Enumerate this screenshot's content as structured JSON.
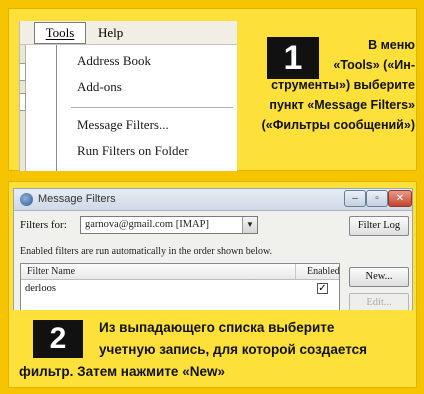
{
  "step1": {
    "number": "1",
    "caption_lines": [
      "В меню",
      "«Tools» («Ин-",
      "струменты») выберите",
      "пункт «Message Filters»",
      "(«Фильтры сообщений»)"
    ],
    "menubar": {
      "tools": "Tools",
      "help": "Help"
    },
    "menu_items": {
      "address_book": "Address Book",
      "addons": "Add-ons",
      "message_filters": "Message Filters...",
      "run_filters": "Run Filters on Folder"
    }
  },
  "step2": {
    "number": "2",
    "caption_lines": [
      "Из выпадающего списка выберите",
      "учетную запись, для которой создается",
      "фильтр. Затем нажмите «New»"
    ],
    "window": {
      "title": "Message Filters",
      "filters_for_label": "Filters for:",
      "account_value": "garnova@gmail.com [IMAP]",
      "filter_log_button": "Filter Log",
      "note": "Enabled filters are run automatically in the order shown below.",
      "columns": {
        "name": "Filter Name",
        "enabled": "Enabled"
      },
      "rows": [
        {
          "name": "derloos",
          "enabled": true
        }
      ],
      "new_button": "New...",
      "edit_button": "Edit..."
    }
  }
}
